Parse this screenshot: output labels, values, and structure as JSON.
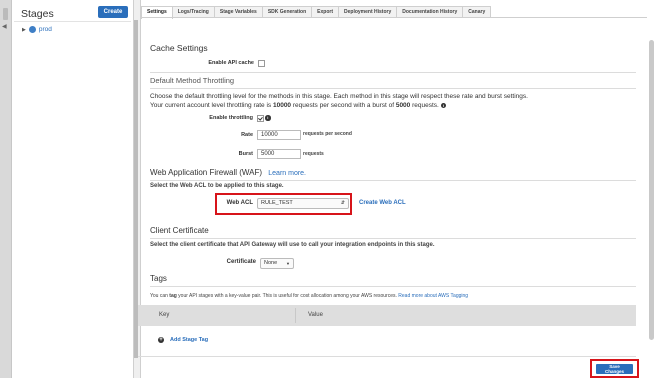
{
  "stages_panel": {
    "title": "Stages",
    "create_label": "Create",
    "items": [
      {
        "label": "prod"
      }
    ]
  },
  "tabs": [
    {
      "label": "Settings",
      "active": true
    },
    {
      "label": "Logs/Tracing"
    },
    {
      "label": "Stage Variables"
    },
    {
      "label": "SDK Generation"
    },
    {
      "label": "Export"
    },
    {
      "label": "Deployment History"
    },
    {
      "label": "Documentation History"
    },
    {
      "label": "Canary"
    }
  ],
  "cache": {
    "heading": "Cache Settings",
    "enable_label": "Enable API cache"
  },
  "throttling": {
    "heading": "Default Method Throttling",
    "desc1": "Choose the default throttling level for the methods in this stage. Each method in this stage will respect these rate and burst settings.",
    "desc2_prefix": "Your current account level throttling rate is ",
    "desc2_rate": "10000",
    "desc2_mid": " requests per second with a burst of ",
    "desc2_burst": "5000",
    "desc2_suffix": " requests.",
    "enable_label": "Enable throttling",
    "rate_label": "Rate",
    "rate_value": "10000",
    "rate_unit": "requests per second",
    "burst_label": "Burst",
    "burst_value": "5000",
    "burst_unit": "requests"
  },
  "waf": {
    "heading": "Web Application Firewall (WAF)",
    "learn_more": "Learn more.",
    "subtext": "Select the Web ACL to be applied to this stage.",
    "acl_label": "Web ACL",
    "acl_value": "RULE_TEST",
    "create_acl": "Create Web ACL"
  },
  "client_cert": {
    "heading": "Client Certificate",
    "subtext": "Select the client certificate that API Gateway will use to call your integration endpoints in this stage.",
    "cert_label": "Certificate",
    "cert_value": "None"
  },
  "tags": {
    "heading": "Tags",
    "desc_prefix": "You can ",
    "desc_tag": "tag",
    "desc_mid": " your API stages with a key-value pair. This is useful for cost allocation among your AWS resources. ",
    "desc_link": "Read more about AWS Tagging",
    "col_key": "Key",
    "col_value": "Value",
    "add_label": "Add Stage Tag"
  },
  "save_label": "Save Changes"
}
